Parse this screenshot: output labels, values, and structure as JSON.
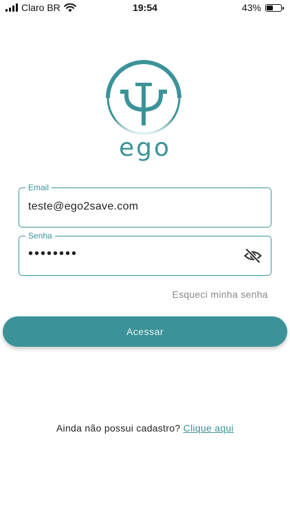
{
  "status_bar": {
    "carrier": "Claro BR",
    "time": "19:54",
    "battery_percent": "43%",
    "battery_level": 0.43,
    "icons": [
      "signal-icon",
      "wifi-icon",
      "battery-icon"
    ]
  },
  "logo": {
    "symbol": "Ψ",
    "word": "ego"
  },
  "form": {
    "email": {
      "label": "Email",
      "value": "teste@ego2save.com"
    },
    "password": {
      "label": "Senha",
      "value": "••••••••",
      "toggle_icon": "eye-off-icon"
    },
    "forgot_label": "Esqueci minha senha",
    "submit_label": "Acessar"
  },
  "signup": {
    "prompt": "Ainda não possui cadastro?",
    "link_label": "Clique aqui"
  },
  "colors": {
    "accent": "#3b9399",
    "text": "#222222",
    "muted": "#888888"
  }
}
